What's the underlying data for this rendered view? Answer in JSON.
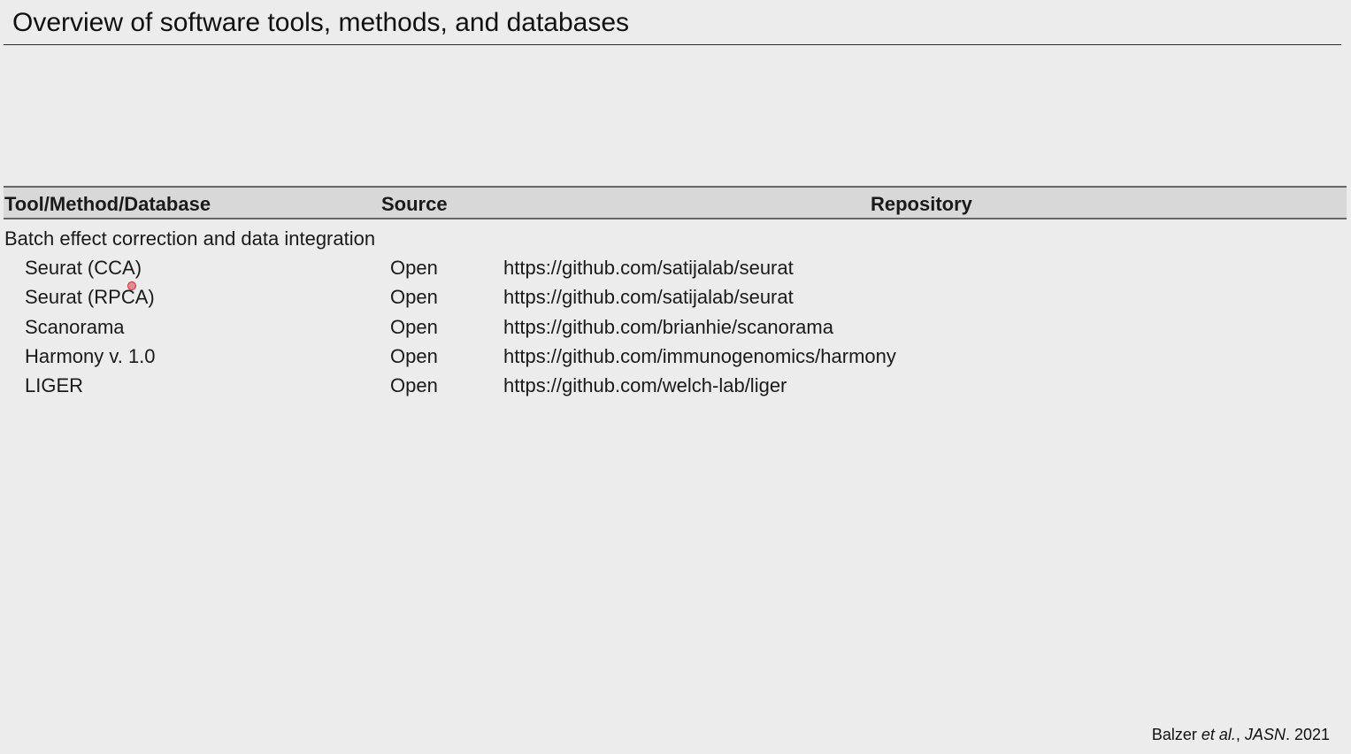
{
  "slide": {
    "title": "Overview of software tools, methods, and databases"
  },
  "table": {
    "headers": {
      "tool": "Tool/Method/Database",
      "source": "Source",
      "repository": "Repository"
    },
    "section_label": "Batch effect correction and data integration",
    "rows": [
      {
        "tool": "Seurat (CCA)",
        "source": "Open",
        "repository": "https://github.com/satijalab/seurat"
      },
      {
        "tool": "Seurat (RPCA)",
        "source": "Open",
        "repository": "https://github.com/satijalab/seurat"
      },
      {
        "tool": "Scanorama",
        "source": "Open",
        "repository": "https://github.com/brianhie/scanorama"
      },
      {
        "tool": "Harmony v. 1.0",
        "source": "Open",
        "repository": "https://github.com/immunogenomics/harmony"
      },
      {
        "tool": "LIGER",
        "source": "Open",
        "repository": "https://github.com/welch-lab/liger"
      }
    ]
  },
  "citation": {
    "author": "Balzer ",
    "etal": "et al.",
    "sep": ", ",
    "journal": "JASN",
    "year": ". 2021"
  }
}
